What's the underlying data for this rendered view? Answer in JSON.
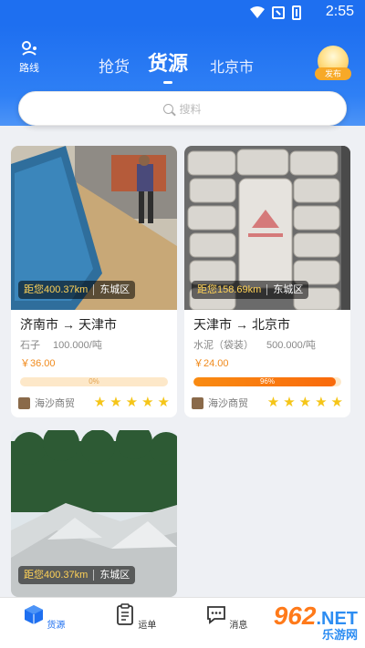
{
  "status_bar": {
    "time": "2:55"
  },
  "header": {
    "route_label": "路线",
    "tabs": [
      {
        "label": "抢货",
        "active": false
      },
      {
        "label": "货源",
        "active": true
      }
    ],
    "city": "北京市",
    "publish_label": "发布"
  },
  "search": {
    "placeholder": "搜料"
  },
  "cards": [
    {
      "distance": "距您400.37km",
      "district": "东城区",
      "from": "济南市",
      "to": "天津市",
      "arrow": "→",
      "material": "石子",
      "quantity": "100.000/吨",
      "price": "￥36.00",
      "progress": 0,
      "progress_label": "0%",
      "seller": "海沙商贸",
      "rating": 5
    },
    {
      "distance": "距您158.69km",
      "district": "东城区",
      "from": "天津市",
      "to": "北京市",
      "arrow": "→",
      "material": "水泥（袋装）",
      "quantity": "500.000/吨",
      "price": "￥24.00",
      "progress": 96,
      "progress_label": "96%",
      "seller": "海沙商贸",
      "rating": 5
    },
    {
      "distance": "距您400.37km",
      "district": "东城区"
    }
  ],
  "bottom_nav": [
    {
      "label": "货源",
      "icon": "cube-icon",
      "active": true
    },
    {
      "label": "运单",
      "icon": "clipboard-icon",
      "active": false
    },
    {
      "label": "消息",
      "icon": "chat-icon",
      "active": false
    }
  ],
  "watermark": {
    "part1": "962",
    "part2": ".NET",
    "part3": "乐游网"
  },
  "colors": {
    "primary": "#1e6ff0",
    "accent": "#f98b12",
    "price": "#f08a1c",
    "star": "#f5c518"
  }
}
